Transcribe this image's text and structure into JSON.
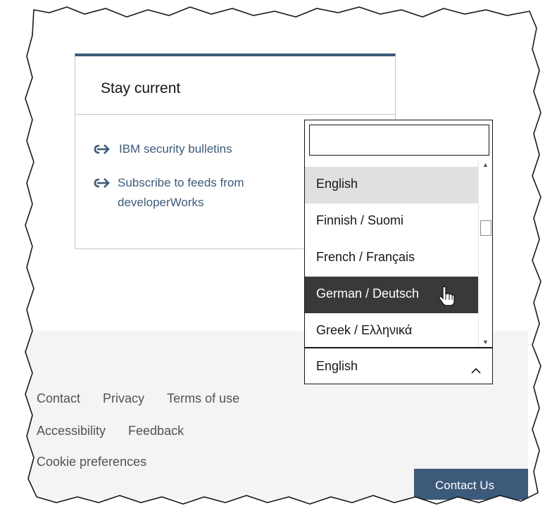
{
  "card": {
    "title": "Stay current",
    "links": [
      "IBM security bulletins",
      "Subscribe to feeds from developerWorks"
    ]
  },
  "footer": {
    "row1": [
      "Contact",
      "Privacy",
      "Terms of use"
    ],
    "row2": [
      "Accessibility",
      "Feedback"
    ],
    "row3": [
      "Cookie preferences"
    ],
    "contact_button": "Contact Us"
  },
  "language_dropdown": {
    "search_value": "",
    "options": [
      "English",
      "Finnish / Suomi",
      "French / Français",
      "German / Deutsch",
      "Greek / Ελληνικά"
    ],
    "selected_option": "English",
    "hovered_option": "German / Deutsch",
    "current_value": "English"
  },
  "colors": {
    "accent": "#3c5a7a",
    "selected_bg": "#e0e0e0",
    "hover_bg": "#393939",
    "footer_bg": "#f4f4f4"
  },
  "icons": [
    "arrow-link-icon",
    "chevron-up-icon",
    "hand-pointer-cursor-icon"
  ]
}
